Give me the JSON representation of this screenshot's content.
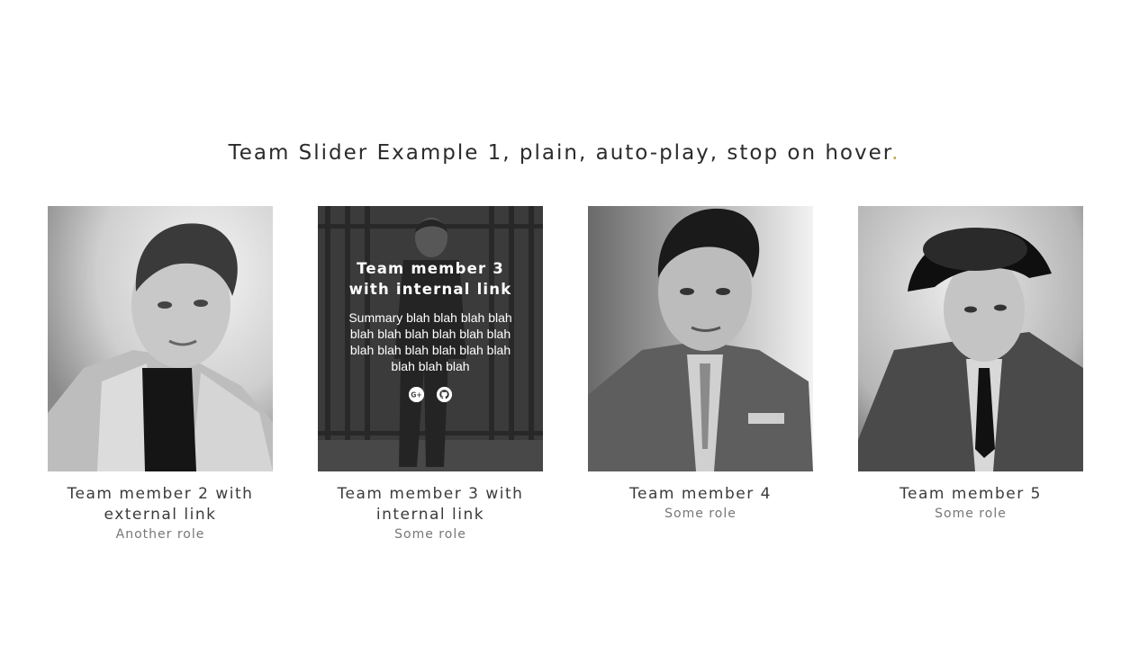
{
  "heading": {
    "text": "Team Slider Example 1, plain, auto-play, stop on hover",
    "dot": "."
  },
  "accent_color": "#c9a24a",
  "members": [
    {
      "name": "Team member 2 with external link",
      "role": "Another role",
      "photo": "portrait-young-man-jacket"
    },
    {
      "name": "Team member 3 with internal link",
      "role": "Some role",
      "photo": "portrait-performer-prison-bars",
      "overlay": {
        "name": "Team member 3 with internal link",
        "summary": "Summary blah blah blah blah blah blah blah blah blah blah blah blah blah blah blah blah blah blah blah",
        "social": [
          {
            "icon": "google-plus-icon"
          },
          {
            "icon": "github-icon"
          }
        ]
      }
    },
    {
      "name": "Team member 4",
      "role": "Some role",
      "photo": "portrait-man-military-uniform"
    },
    {
      "name": "Team member 5",
      "role": "Some role",
      "photo": "portrait-man-fedora-trenchcoat"
    }
  ]
}
